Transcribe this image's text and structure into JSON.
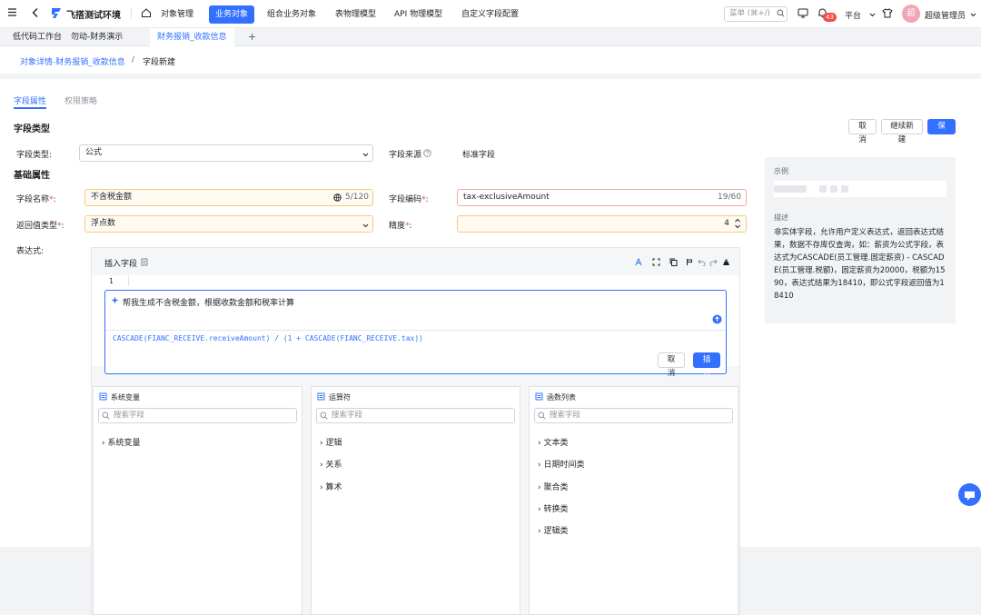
{
  "topbar": {
    "app_name": "飞搭测试环境",
    "nav": [
      "对象管理",
      "业务对象",
      "组合业务对象",
      "表物理模型",
      "API 物理模型",
      "自定义字段配置"
    ],
    "search_placeholder": "菜单 (⌘+/)",
    "badge_count": "43",
    "platform": "平台",
    "avatar_text": "超",
    "user_name": "超级管理员"
  },
  "tabs": [
    "低代码工作台",
    "勿动-财务演示",
    "财务报销_收款信息"
  ],
  "breadcrumb": {
    "parent": "对象详情-财务报销_收款信息",
    "sep": "/",
    "current": "字段新建"
  },
  "subtabs": [
    "字段属性",
    "权限策略"
  ],
  "section": {
    "field_type": "字段类型",
    "basic": "基础属性"
  },
  "actions": {
    "cancel": "取消",
    "continue_new": "继续新建",
    "save": "保存"
  },
  "form": {
    "field_type_label": "字段类型:",
    "field_type_value": "公式",
    "field_source_label": "字段来源",
    "field_source_value": "标准字段",
    "name_label": "字段名称",
    "name_value": "不含税金额",
    "name_count": "5/120",
    "code_label": "字段编码",
    "code_value": "tax-exclusiveAmount",
    "code_count": "19/60",
    "return_type_label": "返回值类型",
    "return_type_value": "浮点数",
    "precision_label": "精度",
    "precision_value": "4",
    "expr_label": "表达式:"
  },
  "editor": {
    "insert_field": "插入字段",
    "line_no": "1",
    "ai_prompt": "帮我生成不含税金额，根据收款金额和税率计算",
    "ai_result": "CASCADE(FIANC_RECEIVE.receiveAmount) / (1 + CASCADE(FIANC_RECEIVE.tax))",
    "cancel": "取消",
    "insert": "插入"
  },
  "panels": [
    {
      "title": "系统变量",
      "placeholder": "搜索字段",
      "items": [
        "系统变量"
      ]
    },
    {
      "title": "运算符",
      "placeholder": "搜索字段",
      "items": [
        "逻辑",
        "关系",
        "算术"
      ]
    },
    {
      "title": "函数列表",
      "placeholder": "搜索字段",
      "items": [
        "文本类",
        "日期时间类",
        "聚合类",
        "转换类",
        "逻辑类"
      ]
    }
  ],
  "side": {
    "example_label": "示例",
    "desc_label": "描述",
    "desc": "非实体字段，允许用户定义表达式，返回表达式结果，数据不存库仅查询，如：薪资为公式字段，表达式为CASCADE(员工管理.固定薪资) - CASCADE(员工管理.税额)，固定薪资为20000，税额为1590，表达式结果为18410，即公式字段返回值为18410"
  },
  "colors": {
    "accent": "#3370ff",
    "required": "#f54a45",
    "badge": "#f54a45"
  }
}
